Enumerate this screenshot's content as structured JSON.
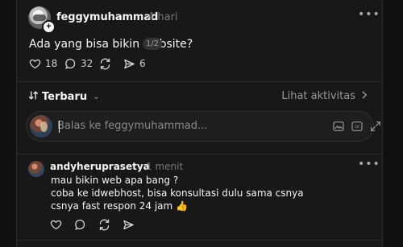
{
  "post": {
    "username": "feggymuhammad",
    "time": "4 hari",
    "text": "Ada yang bisa bikin website?",
    "page_indicator": "1/2",
    "more": "•••",
    "actions": {
      "likes": "18",
      "comments": "32",
      "shares": "6"
    }
  },
  "sort": {
    "label": "Terbaru",
    "activity_label": "Lihat aktivitas"
  },
  "reply_box": {
    "placeholder": "Balas ke feggymuhammad...",
    "gif_label": "GIF"
  },
  "comment": {
    "username": "andyheruprasetya",
    "time": "1 menit",
    "more": "•••",
    "lines": [
      "mau bikin web apa bang ?",
      "coba ke idwebhost, bisa konsultasi dulu sama csnya",
      "csnya fast respon 24 jam 👍"
    ]
  },
  "icons": {
    "like": "heart-icon",
    "comment": "comment-icon",
    "repost": "repost-icon",
    "share": "send-icon",
    "sort": "sort-icon",
    "chevron": "chevron-icon",
    "image": "image-icon",
    "gif": "gif-icon",
    "expand": "expand-icon"
  },
  "colors": {
    "background": "#101010",
    "card": "#181818",
    "text": "#f3f5f7",
    "muted": "#777777"
  }
}
